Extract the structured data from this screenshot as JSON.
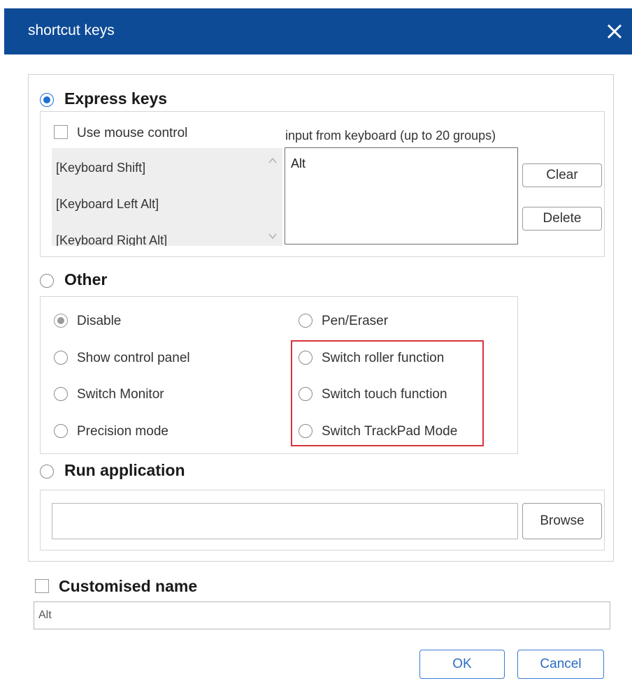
{
  "window": {
    "title": "shortcut keys"
  },
  "express_keys": {
    "label": "Express keys",
    "mouse_control_label": "Use mouse control",
    "keyboard_input_label": "input from keyboard (up to 20 groups)",
    "key_list": [
      "[Keyboard Shift]",
      "[Keyboard Left Alt]",
      "[Keyboard Right Alt]"
    ],
    "input_value": "Alt",
    "clear_label": "Clear",
    "delete_label": "Delete"
  },
  "other": {
    "label": "Other",
    "options_left": [
      "Disable",
      "Show control panel",
      "Switch Monitor",
      "Precision mode"
    ],
    "options_right": [
      "Pen/Eraser",
      "Switch roller function",
      "Switch touch function",
      "Switch TrackPad Mode"
    ],
    "selected": "Disable"
  },
  "run_application": {
    "label": "Run application",
    "path_value": "",
    "browse_label": "Browse"
  },
  "customised_name": {
    "label": "Customised name",
    "value": "Alt"
  },
  "footer": {
    "ok_label": "OK",
    "cancel_label": "Cancel"
  },
  "colors": {
    "titlebar": "#0e4b97",
    "accent": "#1f6fd0",
    "highlight": "#d8343a"
  }
}
